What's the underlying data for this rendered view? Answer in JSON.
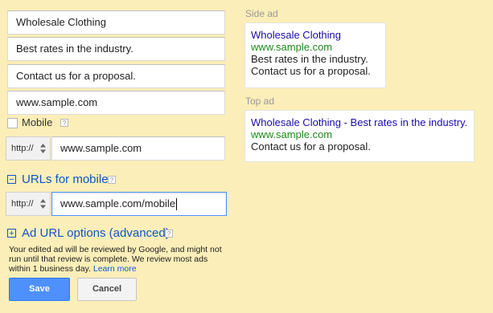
{
  "form": {
    "headline": "Wholesale Clothing",
    "line1": "Best rates in the industry.",
    "line2": "Contact us for a proposal.",
    "display_url": "www.sample.com",
    "mobile_label": "Mobile",
    "help_glyph": "?",
    "final_url": {
      "protocol": "http://",
      "value": "www.sample.com"
    },
    "mobile_section": {
      "toggle": "−",
      "label": "URLs for mobile"
    },
    "mobile_url": {
      "protocol": "http://",
      "value": "www.sample.com/mobile"
    },
    "advanced_section": {
      "toggle": "+",
      "label": "Ad URL options (advanced)"
    },
    "review_note": {
      "lines": [
        "Your edited ad will be reviewed by Google, and might not",
        "run until that review is complete. We review most ads",
        "within 1 business day."
      ],
      "link": "Learn more"
    },
    "save_label": "Save",
    "cancel_label": "Cancel"
  },
  "preview": {
    "side_ad": {
      "label": "Side ad",
      "title": "Wholesale Clothing",
      "url": "www.sample.com",
      "line1": "Best rates in the industry.",
      "line2": "Contact us for a proposal."
    },
    "top_ad": {
      "label": "Top ad",
      "title": "Wholesale Clothing - Best rates in the industry.",
      "url": "www.sample.com",
      "line1": "Contact us for a proposal."
    }
  },
  "colors": {
    "background": "#fbeeb8",
    "link": "#1155cc",
    "ad_title": "#1a0dab",
    "ad_url": "#1e8a1e",
    "primary_button": "#4d90fe"
  },
  "icons": {
    "protocol_selector": "up-down-arrows-icon",
    "help": "help-icon",
    "collapse": "minus-box-icon",
    "expand": "plus-box-icon"
  }
}
